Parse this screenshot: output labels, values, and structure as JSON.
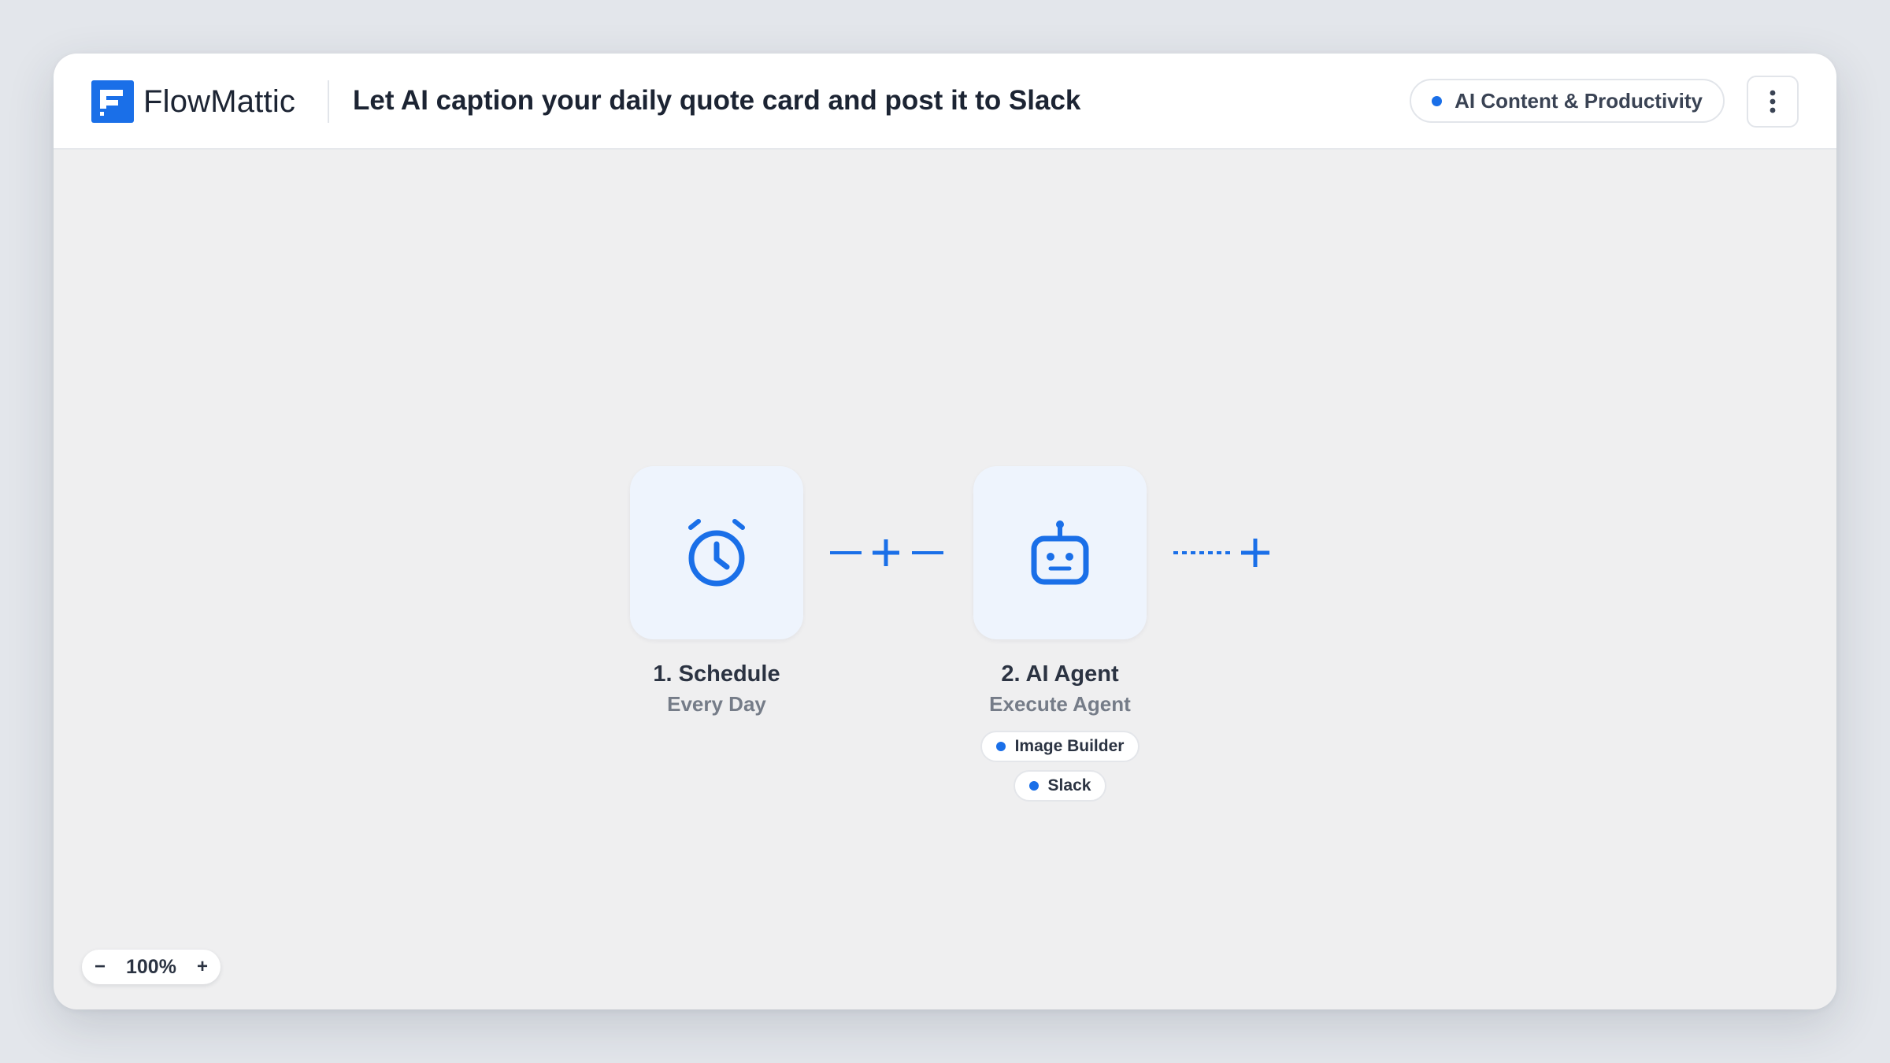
{
  "app": {
    "name": "FlowMattic",
    "title": "Let AI caption your daily quote card and post it to Slack",
    "accent_color": "#1a6fe8"
  },
  "header": {
    "category": "AI Content & Productivity",
    "more_icon": "vertical-ellipsis-icon"
  },
  "workflow": {
    "steps": [
      {
        "title": "1. Schedule",
        "subtitle": "Every Day",
        "icon": "alarm-clock-icon"
      },
      {
        "title": "2. AI Agent",
        "subtitle": "Execute Agent",
        "icon": "robot-icon",
        "tools": [
          "Image Builder",
          "Slack"
        ]
      }
    ],
    "connector_icon": "plus-icon",
    "add_step_icon": "plus-icon"
  },
  "zoom": {
    "level": "100%",
    "out_label": "−",
    "in_label": "+"
  }
}
